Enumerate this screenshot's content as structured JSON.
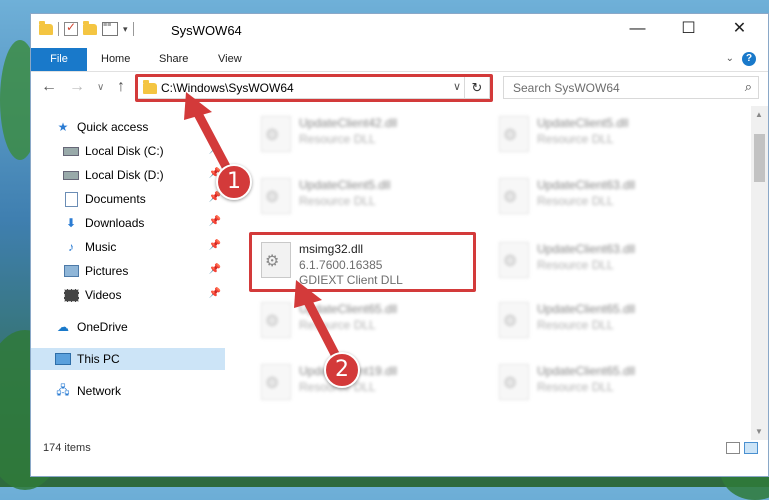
{
  "window": {
    "title": "SysWOW64"
  },
  "ribbon": {
    "tabs": [
      "File",
      "Home",
      "Share",
      "View"
    ]
  },
  "address": {
    "path": "C:\\Windows\\SysWOW64"
  },
  "search": {
    "placeholder": "Search SysWOW64"
  },
  "nav": {
    "items": [
      {
        "label": "Quick access",
        "icon": "star-icon",
        "pinned": false
      },
      {
        "label": "Local Disk (C:)",
        "icon": "drive-icon",
        "pinned": true
      },
      {
        "label": "Local Disk (D:)",
        "icon": "drive-icon",
        "pinned": true
      },
      {
        "label": "Documents",
        "icon": "documents-icon",
        "pinned": true
      },
      {
        "label": "Downloads",
        "icon": "downloads-icon",
        "pinned": true
      },
      {
        "label": "Music",
        "icon": "music-icon",
        "pinned": true
      },
      {
        "label": "Pictures",
        "icon": "pictures-icon",
        "pinned": true
      },
      {
        "label": "Videos",
        "icon": "videos-icon",
        "pinned": true
      },
      {
        "label": "OneDrive",
        "icon": "cloud-icon",
        "pinned": false
      },
      {
        "label": "This PC",
        "icon": "computer-icon",
        "pinned": false,
        "selected": true
      },
      {
        "label": "Network",
        "icon": "network-icon",
        "pinned": false
      }
    ]
  },
  "files": {
    "left": [
      {
        "name": "UpdateClient42.dll",
        "desc": "Resource DLL",
        "blurred": true
      },
      {
        "name": "UpdateClient5.dll",
        "desc": "Resource DLL",
        "blurred": true
      },
      {
        "name": "msimg32.dll",
        "version": "6.1.7600.16385",
        "desc": "GDIEXT Client DLL",
        "blurred": false
      },
      {
        "name": "UpdateClient65.dll",
        "desc": "Resource DLL",
        "blurred": true
      },
      {
        "name": "UpdateClient19.dll",
        "desc": "Resource DLL",
        "blurred": true
      }
    ],
    "right": [
      {
        "name": "UpdateClient5.dll",
        "desc": "Resource DLL",
        "blurred": true
      },
      {
        "name": "UpdateClient63.dll",
        "desc": "Resource DLL",
        "blurred": true
      },
      {
        "name": "UpdateClient63.dll",
        "desc": "Resource DLL",
        "blurred": true
      },
      {
        "name": "UpdateClient65.dll",
        "desc": "Resource DLL",
        "blurred": true
      },
      {
        "name": "UpdateClient65.dll",
        "desc": "Resource DLL",
        "blurred": true
      }
    ]
  },
  "status": {
    "count": "174 items"
  },
  "callouts": {
    "one": "1",
    "two": "2"
  },
  "colors": {
    "accent": "#1979ca",
    "highlight": "#d33a3a",
    "selection": "#cce4f7"
  }
}
